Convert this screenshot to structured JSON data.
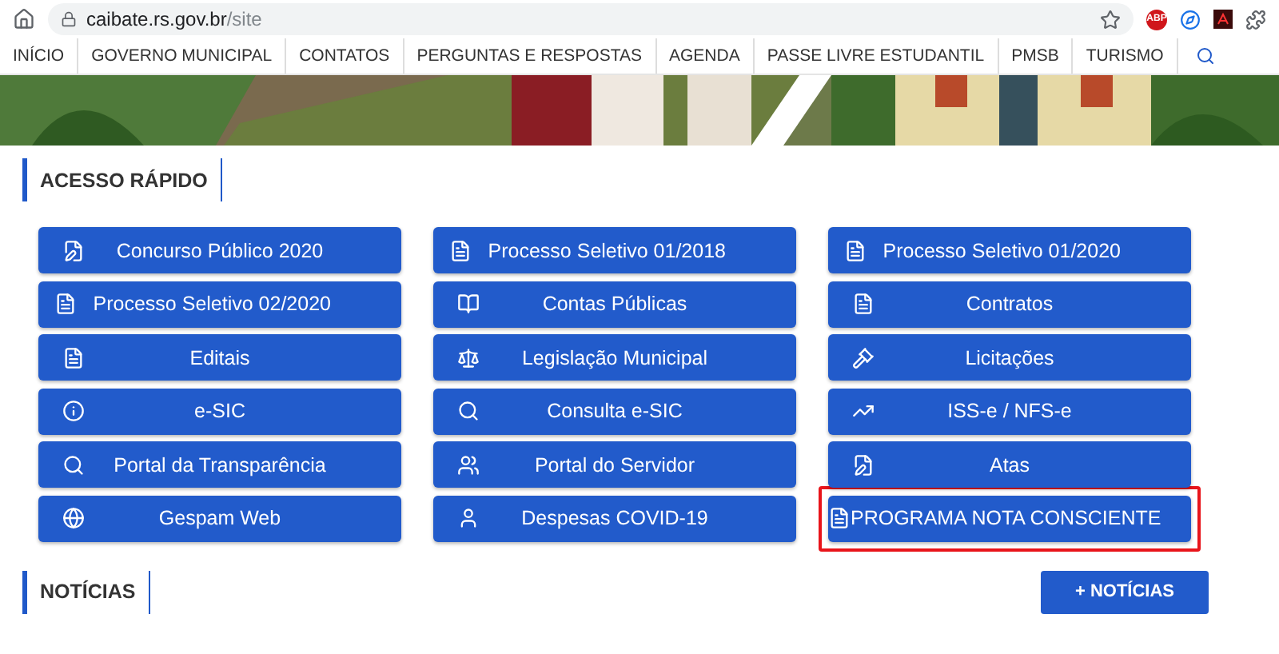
{
  "browser": {
    "url_host": "caibate.rs.gov.br",
    "url_path": "/site",
    "extension_badge": "ABP"
  },
  "nav": {
    "items": [
      {
        "label": "INÍCIO"
      },
      {
        "label": "GOVERNO MUNICIPAL"
      },
      {
        "label": "CONTATOS"
      },
      {
        "label": "PERGUNTAS E RESPOSTAS"
      },
      {
        "label": "AGENDA"
      },
      {
        "label": "PASSE LIVRE ESTUDANTIL"
      },
      {
        "label": "PMSB"
      },
      {
        "label": "TURISMO"
      }
    ]
  },
  "quick_access": {
    "title": "ACESSO RÁPIDO",
    "buttons": [
      {
        "label": "Concurso Público 2020",
        "highlighted": false
      },
      {
        "label": "Processo Seletivo 01/2018",
        "highlighted": false
      },
      {
        "label": "Processo Seletivo 01/2020",
        "highlighted": false
      },
      {
        "label": "Processo Seletivo 02/2020",
        "highlighted": false
      },
      {
        "label": "Contas Públicas",
        "highlighted": false
      },
      {
        "label": "Contratos",
        "highlighted": false
      },
      {
        "label": "Editais",
        "highlighted": false
      },
      {
        "label": "Legislação Municipal",
        "highlighted": false
      },
      {
        "label": "Licitações",
        "highlighted": false
      },
      {
        "label": "e-SIC",
        "highlighted": false
      },
      {
        "label": "Consulta e-SIC",
        "highlighted": false
      },
      {
        "label": "ISS-e / NFS-e",
        "highlighted": false
      },
      {
        "label": "Portal da Transparência",
        "highlighted": false
      },
      {
        "label": "Portal do Servidor",
        "highlighted": false
      },
      {
        "label": "Atas",
        "highlighted": false
      },
      {
        "label": "Gespam Web",
        "highlighted": false
      },
      {
        "label": "Despesas COVID-19",
        "highlighted": false
      },
      {
        "label": "PROGRAMA NOTA CONSCIENTE",
        "highlighted": true
      }
    ]
  },
  "news": {
    "title": "NOTÍCIAS",
    "more_button": "+ NOTÍCIAS"
  }
}
